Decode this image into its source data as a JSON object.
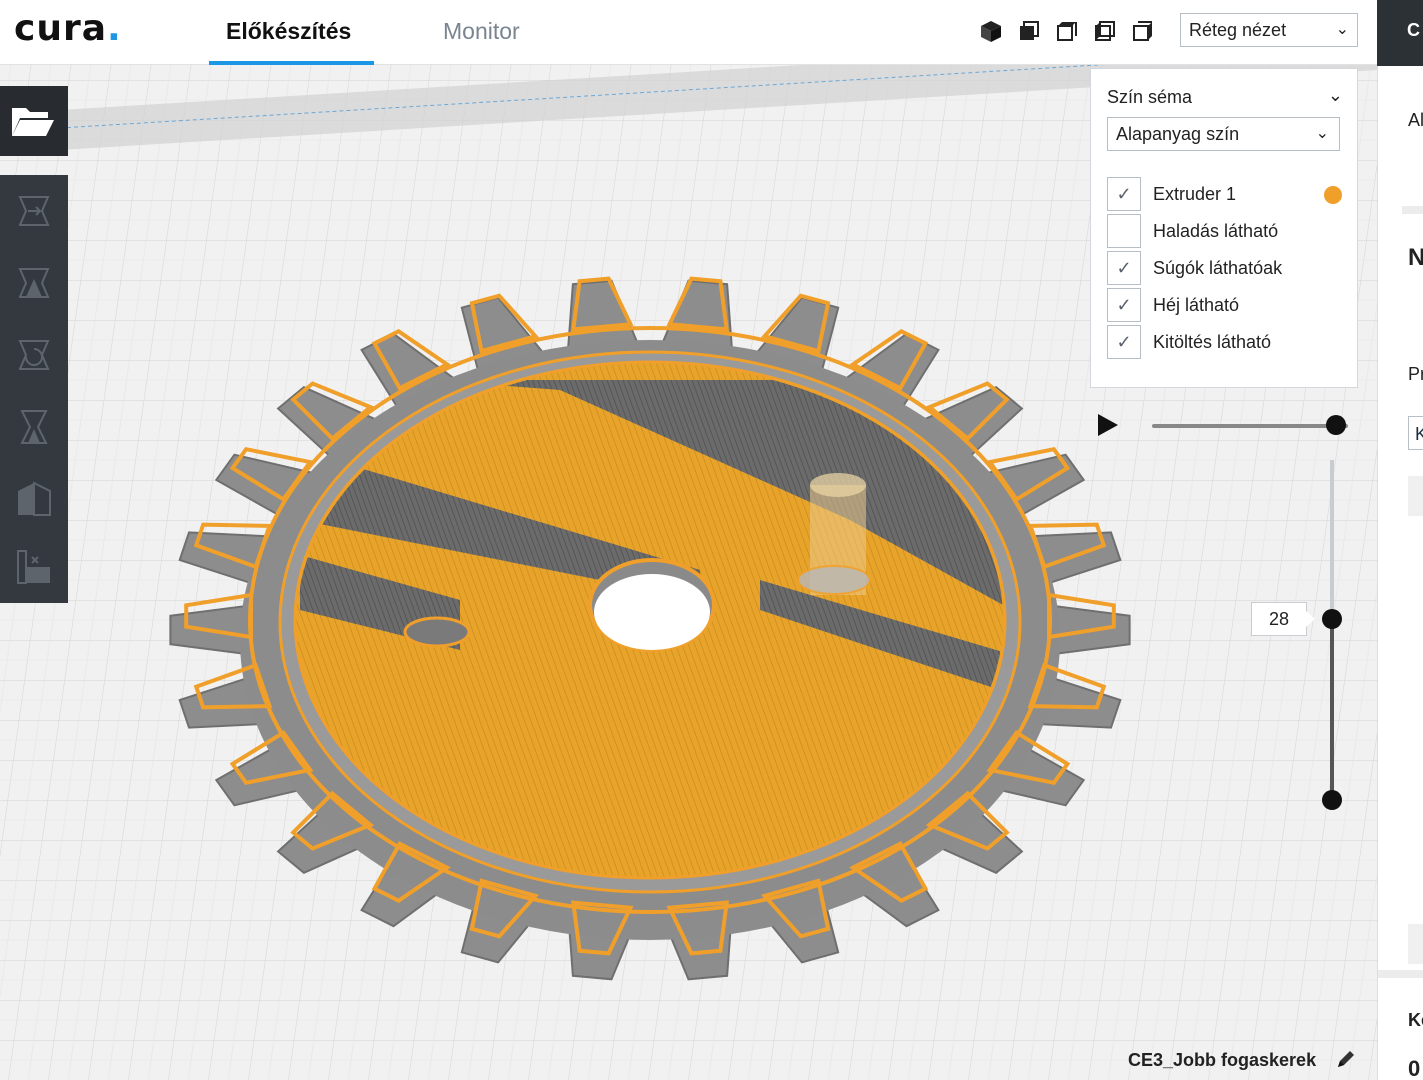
{
  "app": {
    "logo_text": "cura",
    "logo_dot": ".",
    "accent_color": "#1e96e6"
  },
  "header": {
    "tabs": [
      {
        "label": "Előkészítés",
        "active": true
      },
      {
        "label": "Monitor",
        "active": false
      }
    ],
    "view_icons": [
      "3d-view-icon",
      "front-view-icon",
      "top-view-icon",
      "left-view-icon",
      "right-view-icon"
    ],
    "view_mode": "Réteg nézet"
  },
  "left_toolbar": {
    "open_icon": "folder-open-icon",
    "tools": [
      "move-tool-icon",
      "scale-tool-icon",
      "rotate-tool-icon",
      "mirror-tool-icon",
      "per-model-settings-icon",
      "support-blocker-icon"
    ]
  },
  "color_scheme_panel": {
    "title": "Szín séma",
    "scheme_value": "Alapanyag szín",
    "options": [
      {
        "label": "Extruder 1",
        "checked": true,
        "color": "#f0a02a"
      },
      {
        "label": "Haladás látható",
        "checked": false
      },
      {
        "label": "Súgók láthatóak",
        "checked": true
      },
      {
        "label": "Héj látható",
        "checked": true
      },
      {
        "label": "Kitöltés látható",
        "checked": true
      }
    ]
  },
  "layer_view": {
    "current_layer": "28",
    "playback_icon": "play-icon"
  },
  "right_panel": {
    "header_text": "C",
    "lines": [
      "Al",
      "N",
      "Pr",
      "K",
      "Ke",
      "0"
    ]
  },
  "job": {
    "name": "CE3_Jobb fogaskerek",
    "edit_icon": "pencil-icon"
  },
  "model": {
    "filament_color": "#f0a02a",
    "shell_color": "#8a8a8a"
  }
}
